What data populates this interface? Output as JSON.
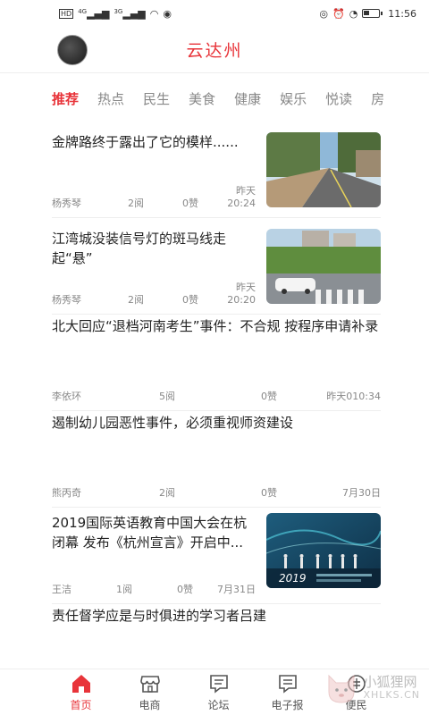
{
  "status_bar": {
    "left_badges": [
      "HD",
      "4G",
      "3G"
    ],
    "time": "11:56"
  },
  "header": {
    "title": "云达州"
  },
  "tabs": [
    "推荐",
    "热点",
    "民生",
    "美食",
    "健康",
    "娱乐",
    "悦读",
    "房"
  ],
  "feed": [
    {
      "title": "金牌路终于露出了它的模样......",
      "author": "杨秀琴",
      "reads": "2阅",
      "likes": "0赞",
      "time": "昨天\n20:24",
      "has_image": true,
      "image": "road-photo"
    },
    {
      "title": "江湾城没装信号灯的斑马线走起“悬”",
      "author": "杨秀琴",
      "reads": "2阅",
      "likes": "0赞",
      "time": "昨天\n20:20",
      "has_image": true,
      "image": "crosswalk-photo"
    },
    {
      "title": "北大回应“退档河南考生”事件：不合规 按程序申请补录",
      "author": "李依环",
      "reads": "5阅",
      "likes": "0赞",
      "time": "昨天010:34",
      "has_image": false
    },
    {
      "title": "遏制幼儿园恶性事件，必须重视师资建设",
      "author": "熊丙奇",
      "reads": "2阅",
      "likes": "0赞",
      "time": "7月30日",
      "has_image": false
    },
    {
      "title": "2019国际英语教育中国大会在杭闭幕 发布《杭州宣言》开启中...",
      "author": "王洁",
      "reads": "1阅",
      "likes": "0赞",
      "time": "7月31日",
      "has_image": true,
      "image": "conference-photo",
      "image_caption": "2019"
    },
    {
      "title": "责任督学应是与时俱进的学习者吕建",
      "has_image": false
    }
  ],
  "bottom_nav": [
    {
      "label": "首页",
      "icon": "home-icon",
      "active": true
    },
    {
      "label": "电商",
      "icon": "shop-icon",
      "active": false
    },
    {
      "label": "论坛",
      "icon": "forum-icon",
      "active": false
    },
    {
      "label": "电子报",
      "icon": "newspaper-icon",
      "active": false
    },
    {
      "label": "便民",
      "icon": "service-icon",
      "active": false
    }
  ],
  "watermark": {
    "text": "小狐狸网",
    "sub": "XHLKS.CN"
  },
  "colors": {
    "accent": "#e8343a",
    "text": "#222222",
    "muted": "#888888"
  }
}
